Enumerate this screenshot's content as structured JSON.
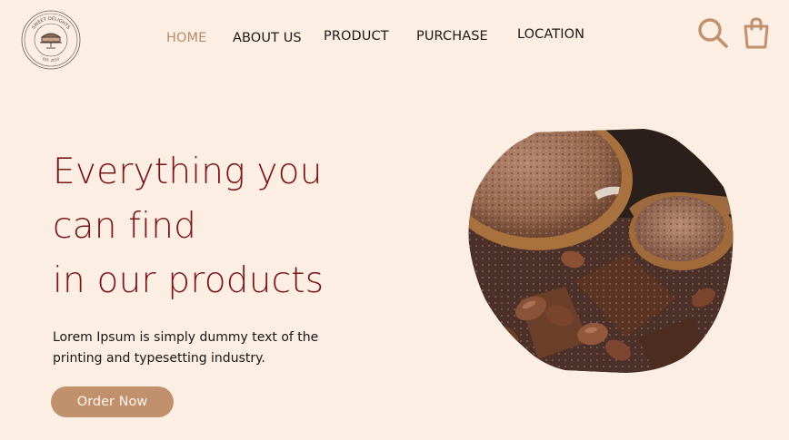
{
  "brand": {
    "logo_icon": "cake-stand-seal-icon",
    "seal_top_text": "SWEET DELIGHTS",
    "seal_bottom_text": "EST. 2010"
  },
  "nav": {
    "items": [
      {
        "label": "HOME",
        "active": true
      },
      {
        "label": "ABOUT US",
        "active": false
      },
      {
        "label": "PRODUCT",
        "active": false
      },
      {
        "label": "PURCHASE",
        "active": false
      },
      {
        "label": "LOCATION",
        "active": false
      }
    ],
    "search_icon": "search-icon",
    "cart_icon": "shopping-bag-icon"
  },
  "hero": {
    "title_lines": [
      "Everything you",
      "can find",
      "in our products"
    ],
    "description": "Lorem Ipsum is simply dummy text of the printing and typesetting industry.",
    "cta_label": "Order Now",
    "image_subject": "cocoa-powder-and-chocolate-photo"
  },
  "colors": {
    "background": "#fdeee4",
    "accent": "#c1906d",
    "nav_active": "#b8896a",
    "title": "#7a1616",
    "text": "#161616"
  }
}
